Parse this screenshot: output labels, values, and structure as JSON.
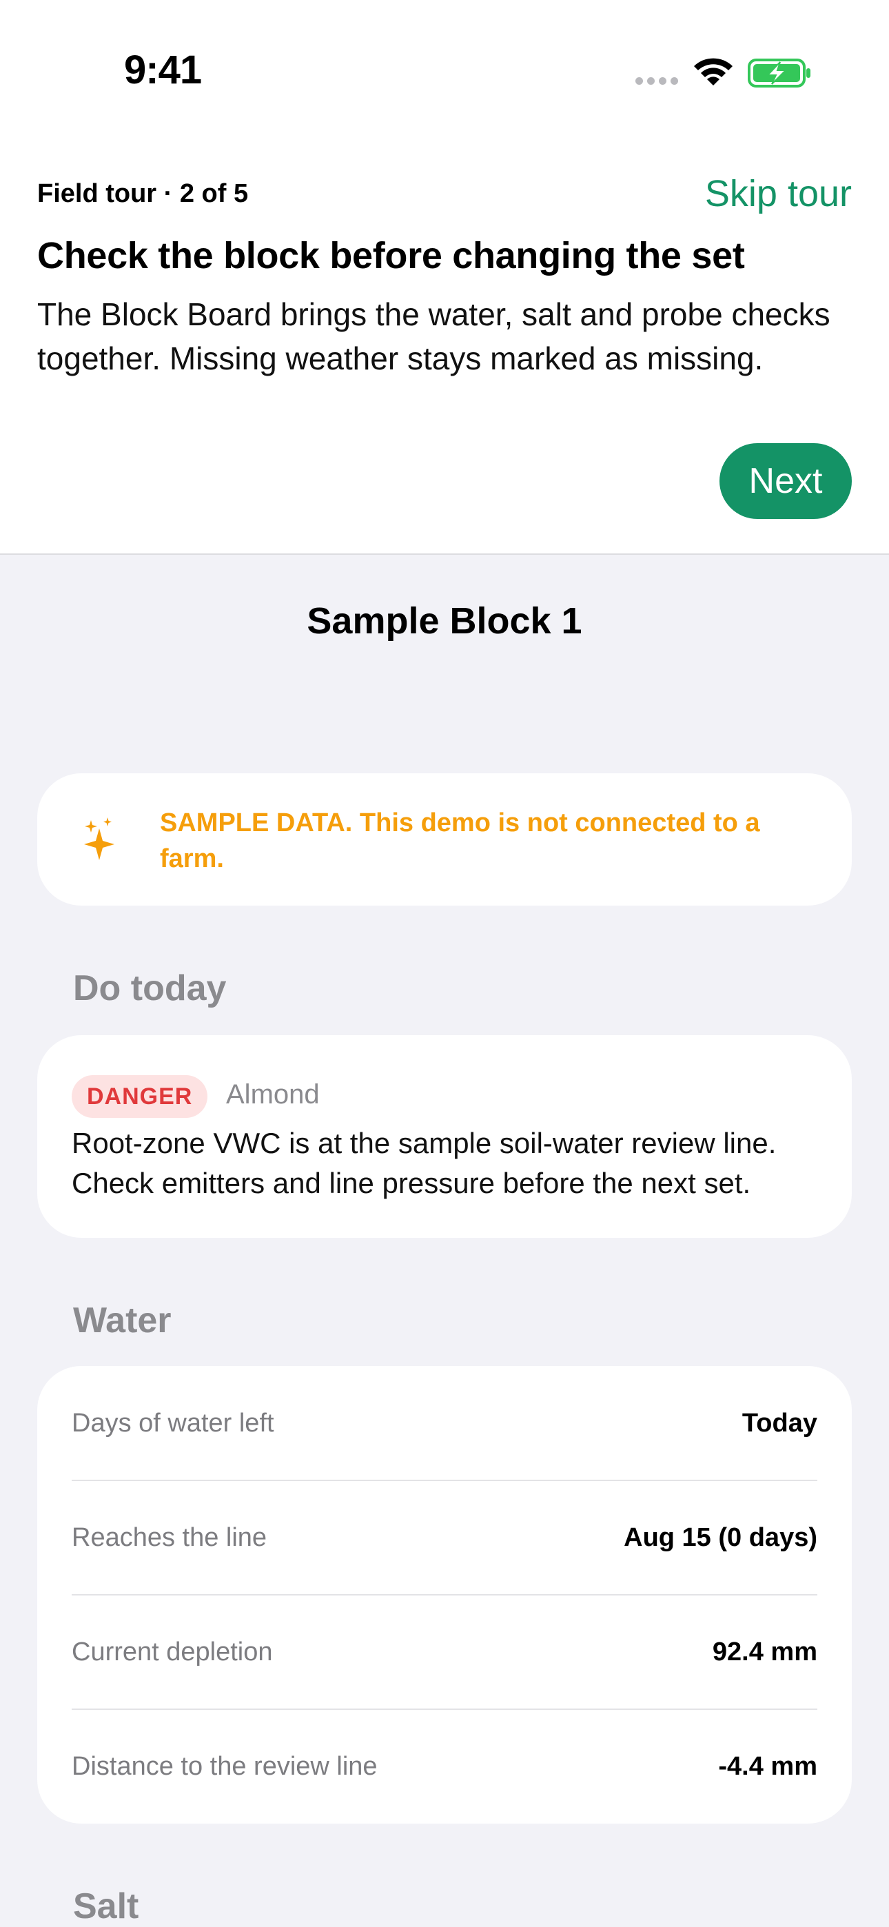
{
  "status_bar": {
    "time": "9:41"
  },
  "tour": {
    "step": "Field tour · 2 of 5",
    "skip_label": "Skip tour",
    "title": "Check the block before changing the set",
    "body": "The Block Board brings the water, salt and probe checks together. Missing weather stays marked as missing.",
    "next_label": "Next"
  },
  "nav": {
    "title": "Sample Block 1"
  },
  "sample_banner": {
    "icon": "sparkle-icon",
    "text": "SAMPLE DATA. This demo is not connected to a farm.",
    "color": "#f59e0b"
  },
  "do_today": {
    "header": "Do today",
    "badge": "DANGER",
    "crop": "Almond",
    "message": "Root-zone VWC is at the sample soil-water review line. Check emitters and line pressure before the next set."
  },
  "water": {
    "header": "Water",
    "rows": [
      {
        "label": "Days of water left",
        "value": "Today"
      },
      {
        "label": "Reaches the line",
        "value": "Aug 15 (0 days)"
      },
      {
        "label": "Current depletion",
        "value": "92.4 mm"
      },
      {
        "label": "Distance to the review line",
        "value": "-4.4 mm"
      }
    ]
  },
  "salt": {
    "header": "Salt"
  },
  "colors": {
    "accent": "#149366",
    "danger": "#e0393b",
    "warning": "#f59e0b",
    "background": "#f2f2f7"
  }
}
